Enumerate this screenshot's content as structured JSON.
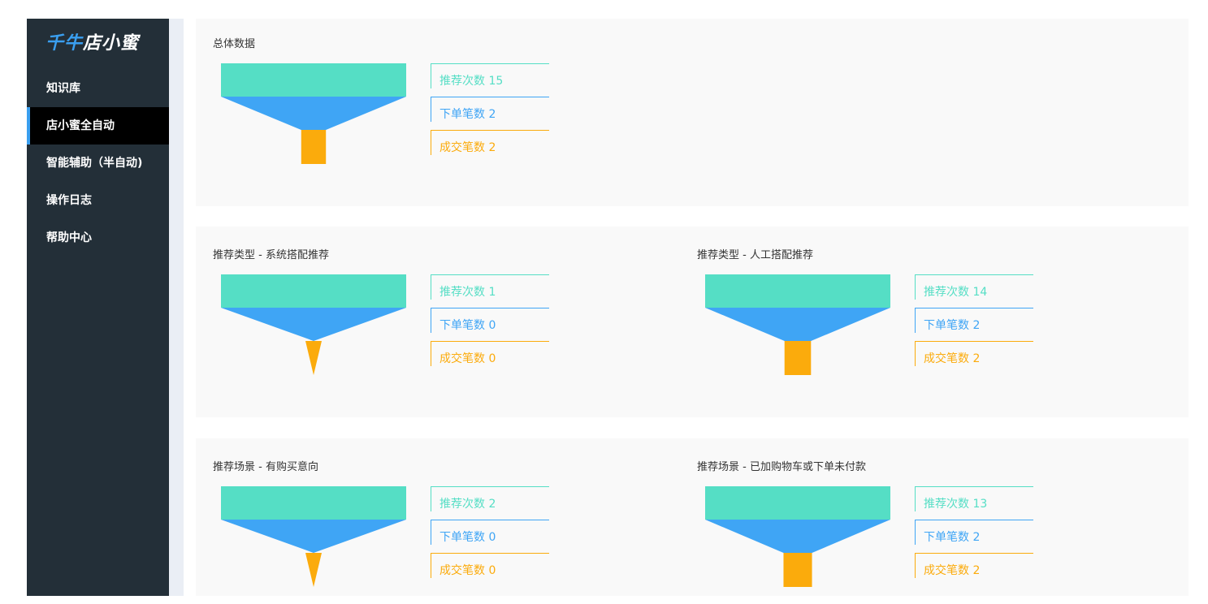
{
  "app": {
    "logo_part1": "千牛",
    "logo_part2": "店小蜜"
  },
  "sidebar": {
    "items": [
      {
        "label": "知识库",
        "active": false
      },
      {
        "label": "店小蜜全自动",
        "active": true
      },
      {
        "label": "智能辅助（半自动)",
        "active": false
      },
      {
        "label": "操作日志",
        "active": false
      },
      {
        "label": "帮助中心",
        "active": false
      }
    ]
  },
  "colors": {
    "recommend": "#55dec5",
    "order": "#3fa5f5",
    "deal": "#fbab0c",
    "sidebar_bg": "#232f38",
    "accent": "#3a9ff0"
  },
  "sections": [
    {
      "blocks": [
        {
          "title": "总体数据",
          "recommend_label": "推荐次数 15",
          "order_label": "下单笔数 2",
          "deal_label": "成交笔数 2",
          "recommend": 15,
          "order": 2,
          "deal": 2
        }
      ]
    },
    {
      "blocks": [
        {
          "title": "推荐类型 - 系统搭配推荐",
          "recommend_label": "推荐次数 1",
          "order_label": "下单笔数 0",
          "deal_label": "成交笔数 0",
          "recommend": 1,
          "order": 0,
          "deal": 0
        },
        {
          "title": "推荐类型 - 人工搭配推荐",
          "recommend_label": "推荐次数 14",
          "order_label": "下单笔数 2",
          "deal_label": "成交笔数 2",
          "recommend": 14,
          "order": 2,
          "deal": 2
        }
      ]
    },
    {
      "blocks": [
        {
          "title": "推荐场景 - 有购买意向",
          "recommend_label": "推荐次数 2",
          "order_label": "下单笔数 0",
          "deal_label": "成交笔数 0",
          "recommend": 2,
          "order": 0,
          "deal": 0
        },
        {
          "title": "推荐场景 - 已加购物车或下单未付款",
          "recommend_label": "推荐次数 13",
          "order_label": "下单笔数 2",
          "deal_label": "成交笔数 2",
          "recommend": 13,
          "order": 2,
          "deal": 2
        }
      ]
    }
  ]
}
